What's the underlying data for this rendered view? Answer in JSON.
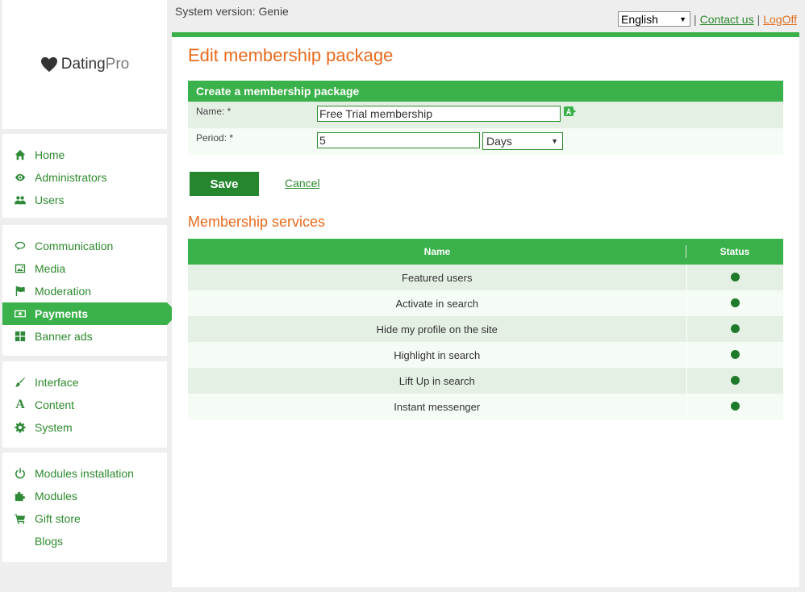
{
  "top": {
    "system_version": "System version: Genie",
    "language": "English",
    "separator": "|",
    "contact_label": "Contact us",
    "logoff_label": "LogOff"
  },
  "logo": {
    "brand_a": "Dating",
    "brand_b": "Pro"
  },
  "sidebar": {
    "groups": [
      [
        {
          "label": "Home",
          "icon": "home-icon"
        },
        {
          "label": "Administrators",
          "icon": "eye-icon"
        },
        {
          "label": "Users",
          "icon": "users-icon"
        }
      ],
      [
        {
          "label": "Communication",
          "icon": "chat-icon"
        },
        {
          "label": "Media",
          "icon": "image-icon"
        },
        {
          "label": "Moderation",
          "icon": "flag-icon"
        },
        {
          "label": "Payments",
          "icon": "money-icon",
          "active": true
        },
        {
          "label": "Banner ads",
          "icon": "grid-icon"
        }
      ],
      [
        {
          "label": "Interface",
          "icon": "brush-icon"
        },
        {
          "label": "Content",
          "icon": "font-icon"
        },
        {
          "label": "System",
          "icon": "gear-icon"
        }
      ],
      [
        {
          "label": "Modules installation",
          "icon": "power-icon"
        },
        {
          "label": "Modules",
          "icon": "puzzle-icon"
        },
        {
          "label": "Gift store",
          "icon": "cart-icon"
        },
        {
          "label": "Blogs",
          "icon": ""
        }
      ]
    ]
  },
  "main": {
    "title": "Edit membership package",
    "form": {
      "header": "Create a membership package",
      "name_label": "Name:  *",
      "name_value": "Free Trial membership",
      "period_label": "Period:  *",
      "period_value": "5",
      "period_unit": "Days"
    },
    "save_label": "Save",
    "cancel_label": "Cancel",
    "services_title": "Membership services",
    "table": {
      "headers": [
        "Name",
        "Status"
      ],
      "rows": [
        {
          "name": "Featured users",
          "status": "active"
        },
        {
          "name": "Activate in search",
          "status": "active"
        },
        {
          "name": "Hide my profile on the site",
          "status": "active"
        },
        {
          "name": "Highlight in search",
          "status": "active"
        },
        {
          "name": "Lift Up in search",
          "status": "active"
        },
        {
          "name": "Instant messenger",
          "status": "active"
        }
      ]
    }
  },
  "colors": {
    "accent_green": "#3ab14a",
    "dark_green": "#25862e",
    "title_orange": "#e86a1c"
  }
}
